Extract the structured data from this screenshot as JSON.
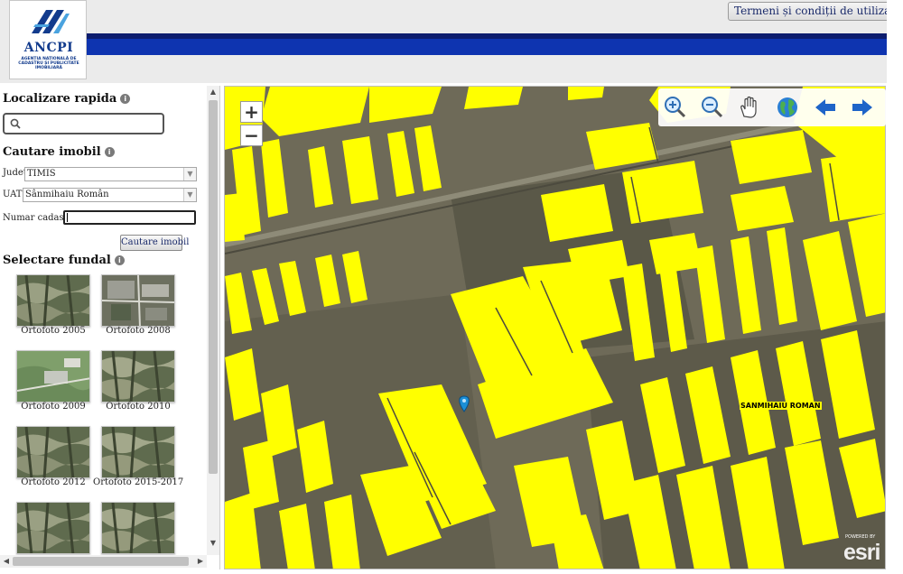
{
  "header": {
    "logo_text": "ANCPI",
    "logo_tagline": "AGENȚIA NAȚIONALĂ DE CADASTRU ȘI PUBLICITATE IMOBILIARĂ",
    "terms_label": "Termeni și condiții de utilizare",
    "colors": {
      "band": "#0e34b0",
      "band_dark": "#0d1d6e",
      "background": "#ebebeb"
    }
  },
  "left_panel": {
    "quick_search": {
      "title": "Localizare rapida",
      "value": "",
      "placeholder": ""
    },
    "property_search": {
      "title": "Cautare imobil",
      "county_label": "Judet:",
      "county_value": "TIMIS",
      "uat_label": "UAT:",
      "uat_value": "Sânmihaiu Român",
      "cadastral_label": "Numar cadastral:",
      "cadastral_value": "",
      "search_button": "Cautare imobil"
    },
    "basemap": {
      "title": "Selectare fundal",
      "items": [
        {
          "label": "Ortofoto 2005"
        },
        {
          "label": "Ortofoto 2008"
        },
        {
          "label": "Ortofoto 2009"
        },
        {
          "label": "Ortofoto 2010"
        },
        {
          "label": "Ortofoto 2012"
        },
        {
          "label": "Ortofoto 2015-2017"
        },
        {
          "label": ""
        },
        {
          "label": ""
        }
      ]
    }
  },
  "map": {
    "zoom_in": "+",
    "zoom_out": "−",
    "tools": [
      "zoom-in-icon",
      "zoom-out-icon",
      "pan-hand-icon",
      "full-extent-globe-icon",
      "previous-extent-arrow-icon",
      "next-extent-arrow-icon"
    ],
    "place_label": "SANMIHAIU ROMAN",
    "esri_logo": "esri",
    "esri_credit": "POWERED BY",
    "colors": {
      "parcels": "#ffff00",
      "ground": "#6e6a58",
      "marker": "#1b8fd6"
    }
  }
}
